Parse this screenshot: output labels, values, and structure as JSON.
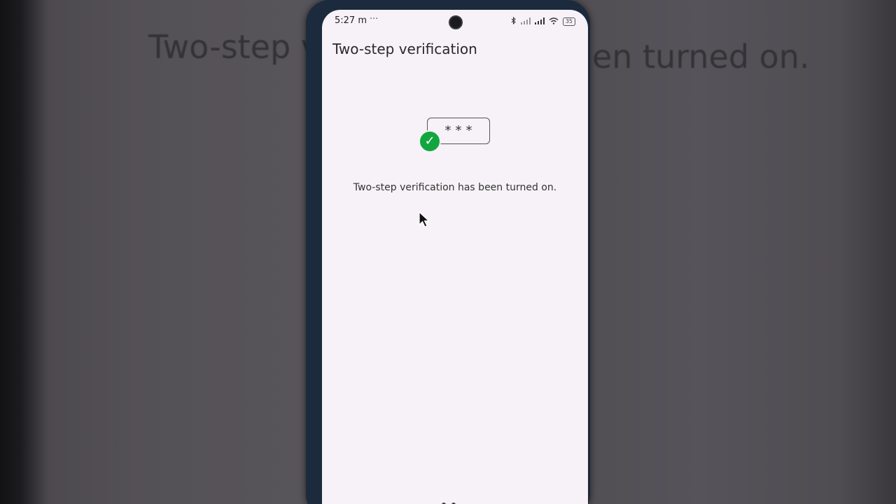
{
  "background": {
    "text_left": "Two-step v",
    "text_right": "en turned on."
  },
  "status_bar": {
    "time": "5:27 m",
    "dots": "···",
    "battery": "35"
  },
  "page": {
    "title": "Two-step verification",
    "password_mask": "***",
    "message": "Two-step verification has been turned on."
  },
  "colors": {
    "screen_bg": "#f6f2f7",
    "check_green": "#13a640"
  }
}
